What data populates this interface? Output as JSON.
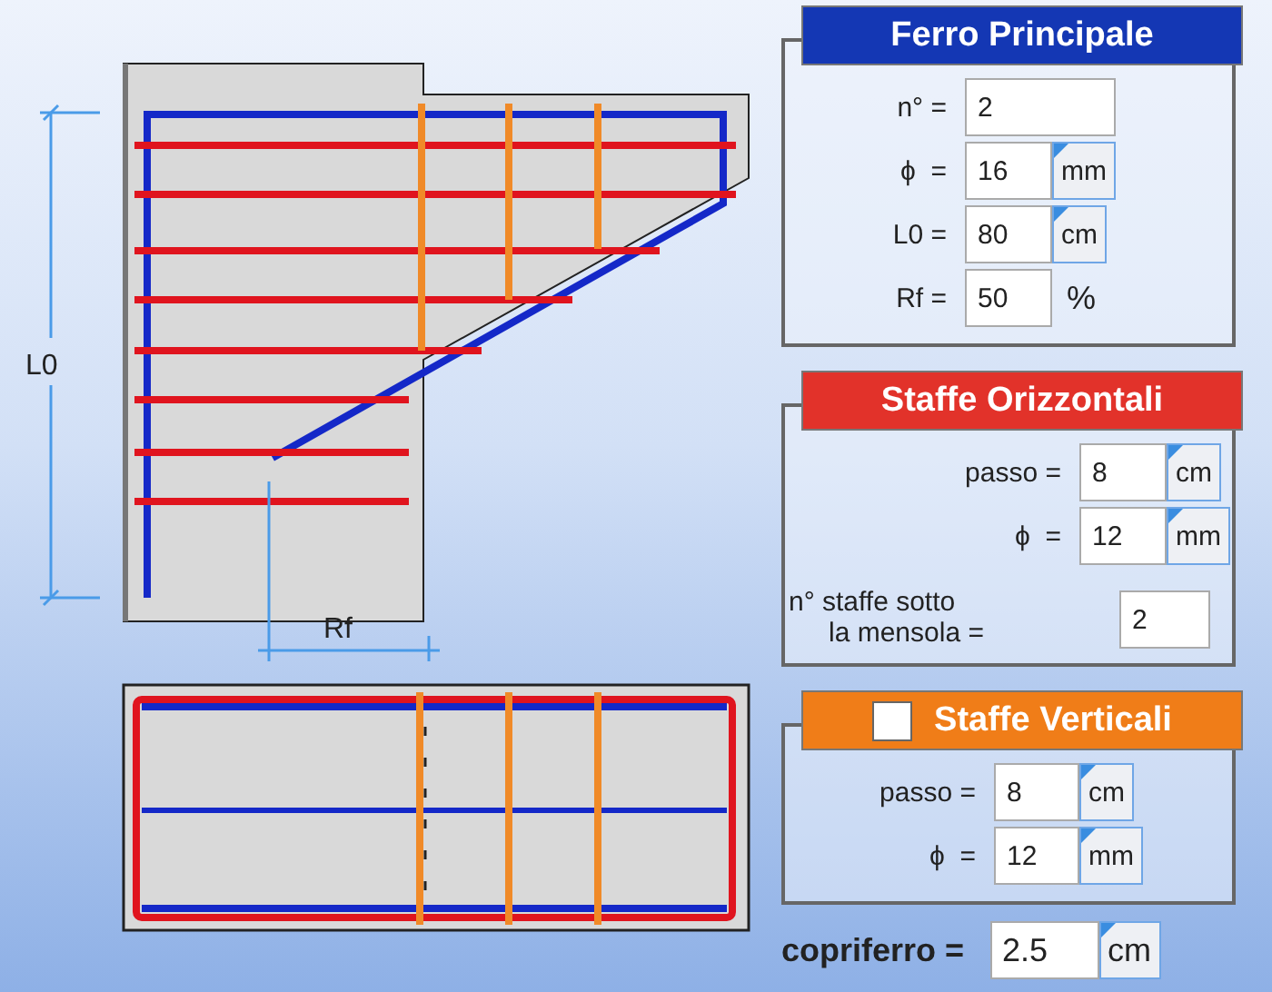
{
  "diagram": {
    "length_label": "L0",
    "offset_label": "Rf"
  },
  "panels": [
    {
      "title": "Ferro Principale",
      "color": "#1437b4",
      "fields": [
        {
          "kind": "inline",
          "label": "n° =",
          "value": "2"
        },
        {
          "kind": "inline",
          "label": "ϕ  =",
          "value": "16",
          "unit": {
            "kind": "select",
            "text": "mm"
          }
        },
        {
          "kind": "inline",
          "label": "L0 =",
          "value": "80",
          "unit": {
            "kind": "select",
            "text": "cm"
          }
        },
        {
          "kind": "inline",
          "label": "Rf =",
          "value": "50",
          "unit": {
            "kind": "text",
            "text": "%"
          }
        }
      ]
    },
    {
      "title": "Staffe Orizzontali",
      "color": "#e2322a",
      "fields": [
        {
          "kind": "inline",
          "label": "passo =",
          "value": "8",
          "unit": {
            "kind": "select",
            "text": "cm"
          }
        },
        {
          "kind": "inline",
          "label": "ϕ  =",
          "value": "12",
          "unit": {
            "kind": "select",
            "text": "mm"
          }
        },
        {
          "kind": "stacked",
          "label": "n° staffe sotto\nla mensola  =",
          "value": "2"
        }
      ]
    },
    {
      "title": "Staffe Verticali",
      "color": "#f07d18",
      "checked": false,
      "fields": [
        {
          "kind": "inline",
          "label": "passo =",
          "value": "8",
          "unit": {
            "kind": "select",
            "text": "cm"
          }
        },
        {
          "kind": "inline",
          "label": "ϕ  =",
          "value": "12",
          "unit": {
            "kind": "select",
            "text": "mm"
          }
        }
      ]
    }
  ],
  "cover": {
    "label": "copriferro =",
    "value": "2.5",
    "unit": "cm"
  }
}
